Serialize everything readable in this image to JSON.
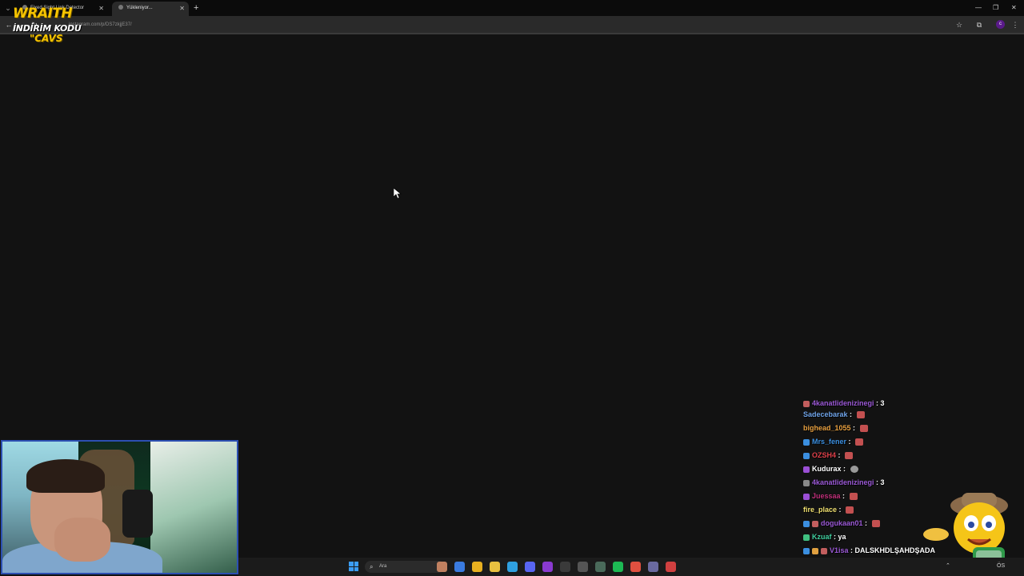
{
  "browser": {
    "tabs": [
      {
        "title": "Fixed Sight Link Detector",
        "active": false
      },
      {
        "title": "Yükleniyor...",
        "active": true
      }
    ],
    "new_tab_label": "+",
    "url": "instagram.com/p/DS7zkjjE37/",
    "profile_initial": "c"
  },
  "overlay_logo": {
    "line1": "WRAITH",
    "line2": "İNDİRİM KODU",
    "line3": "\"CAVS"
  },
  "chat": {
    "messages": [
      {
        "user": "4kanatlidenizinegi",
        "text": "3",
        "color": "#9b59d6",
        "badges": [
          "#c25e5e"
        ],
        "emote": false
      },
      {
        "user": "Sadecebarak",
        "text": "",
        "color": "#6fa3e8",
        "badges": [],
        "emote": true
      },
      {
        "user": "bighead_1055",
        "text": "",
        "color": "#e8a040",
        "badges": [],
        "emote": true
      },
      {
        "user": "Mrs_fener",
        "text": "",
        "color": "#3b8fe0",
        "badges": [
          "#3b8fe0"
        ],
        "emote": true
      },
      {
        "user": "OZSH4",
        "text": "",
        "color": "#e0404a",
        "badges": [
          "#3b8fe0"
        ],
        "emote": true
      },
      {
        "user": "Kudurax",
        "text": "",
        "color": "#ffffff",
        "badges": [
          "#9b4fd6"
        ],
        "emote": true,
        "emote_style": "grey"
      },
      {
        "user": "4kanatlidenizinegi",
        "text": "3",
        "color": "#9b59d6",
        "badges": [
          "#888888"
        ],
        "emote": false
      },
      {
        "user": "Juessaa",
        "text": "",
        "color": "#c0307a",
        "badges": [
          "#9b4fd6"
        ],
        "emote": true
      },
      {
        "user": "fire_place",
        "text": "",
        "color": "#f0e070",
        "badges": [],
        "emote": true
      },
      {
        "user": "dogukaan01",
        "text": "",
        "color": "#9b59d6",
        "badges": [
          "#3b8fe0",
          "#c25e5e"
        ],
        "emote": true
      },
      {
        "user": "Kzuaf",
        "text": "ya",
        "color": "#40d0a0",
        "badges": [
          "#40c080"
        ],
        "emote": false
      },
      {
        "user": "V1isa",
        "text": "DALSKHDLŞAHDŞADA",
        "color": "#9b59d6",
        "badges": [
          "#3b8fe0",
          "#e0a040",
          "#c25e5e"
        ],
        "emote": false
      }
    ]
  },
  "taskbar": {
    "search_placeholder": "Ara",
    "apps": [
      {
        "name": "widgets",
        "color": "#c08060"
      },
      {
        "name": "copilot",
        "color": "#3a7be0"
      },
      {
        "name": "chrome",
        "color": "#e8b020"
      },
      {
        "name": "file-explorer",
        "color": "#e8c040"
      },
      {
        "name": "edge-like",
        "color": "#2fa0e0"
      },
      {
        "name": "discord",
        "color": "#5865f2"
      },
      {
        "name": "app-7",
        "color": "#8a3ad0"
      },
      {
        "name": "app-8",
        "color": "#3a3a3a"
      },
      {
        "name": "app-9",
        "color": "#555555"
      },
      {
        "name": "app-10",
        "color": "#4a6a5a"
      },
      {
        "name": "spotify",
        "color": "#1db954"
      },
      {
        "name": "chrome-2",
        "color": "#e05040"
      },
      {
        "name": "app-13",
        "color": "#6a6aa0"
      },
      {
        "name": "app-14",
        "color": "#d04040"
      }
    ],
    "clock": "ÖS"
  }
}
